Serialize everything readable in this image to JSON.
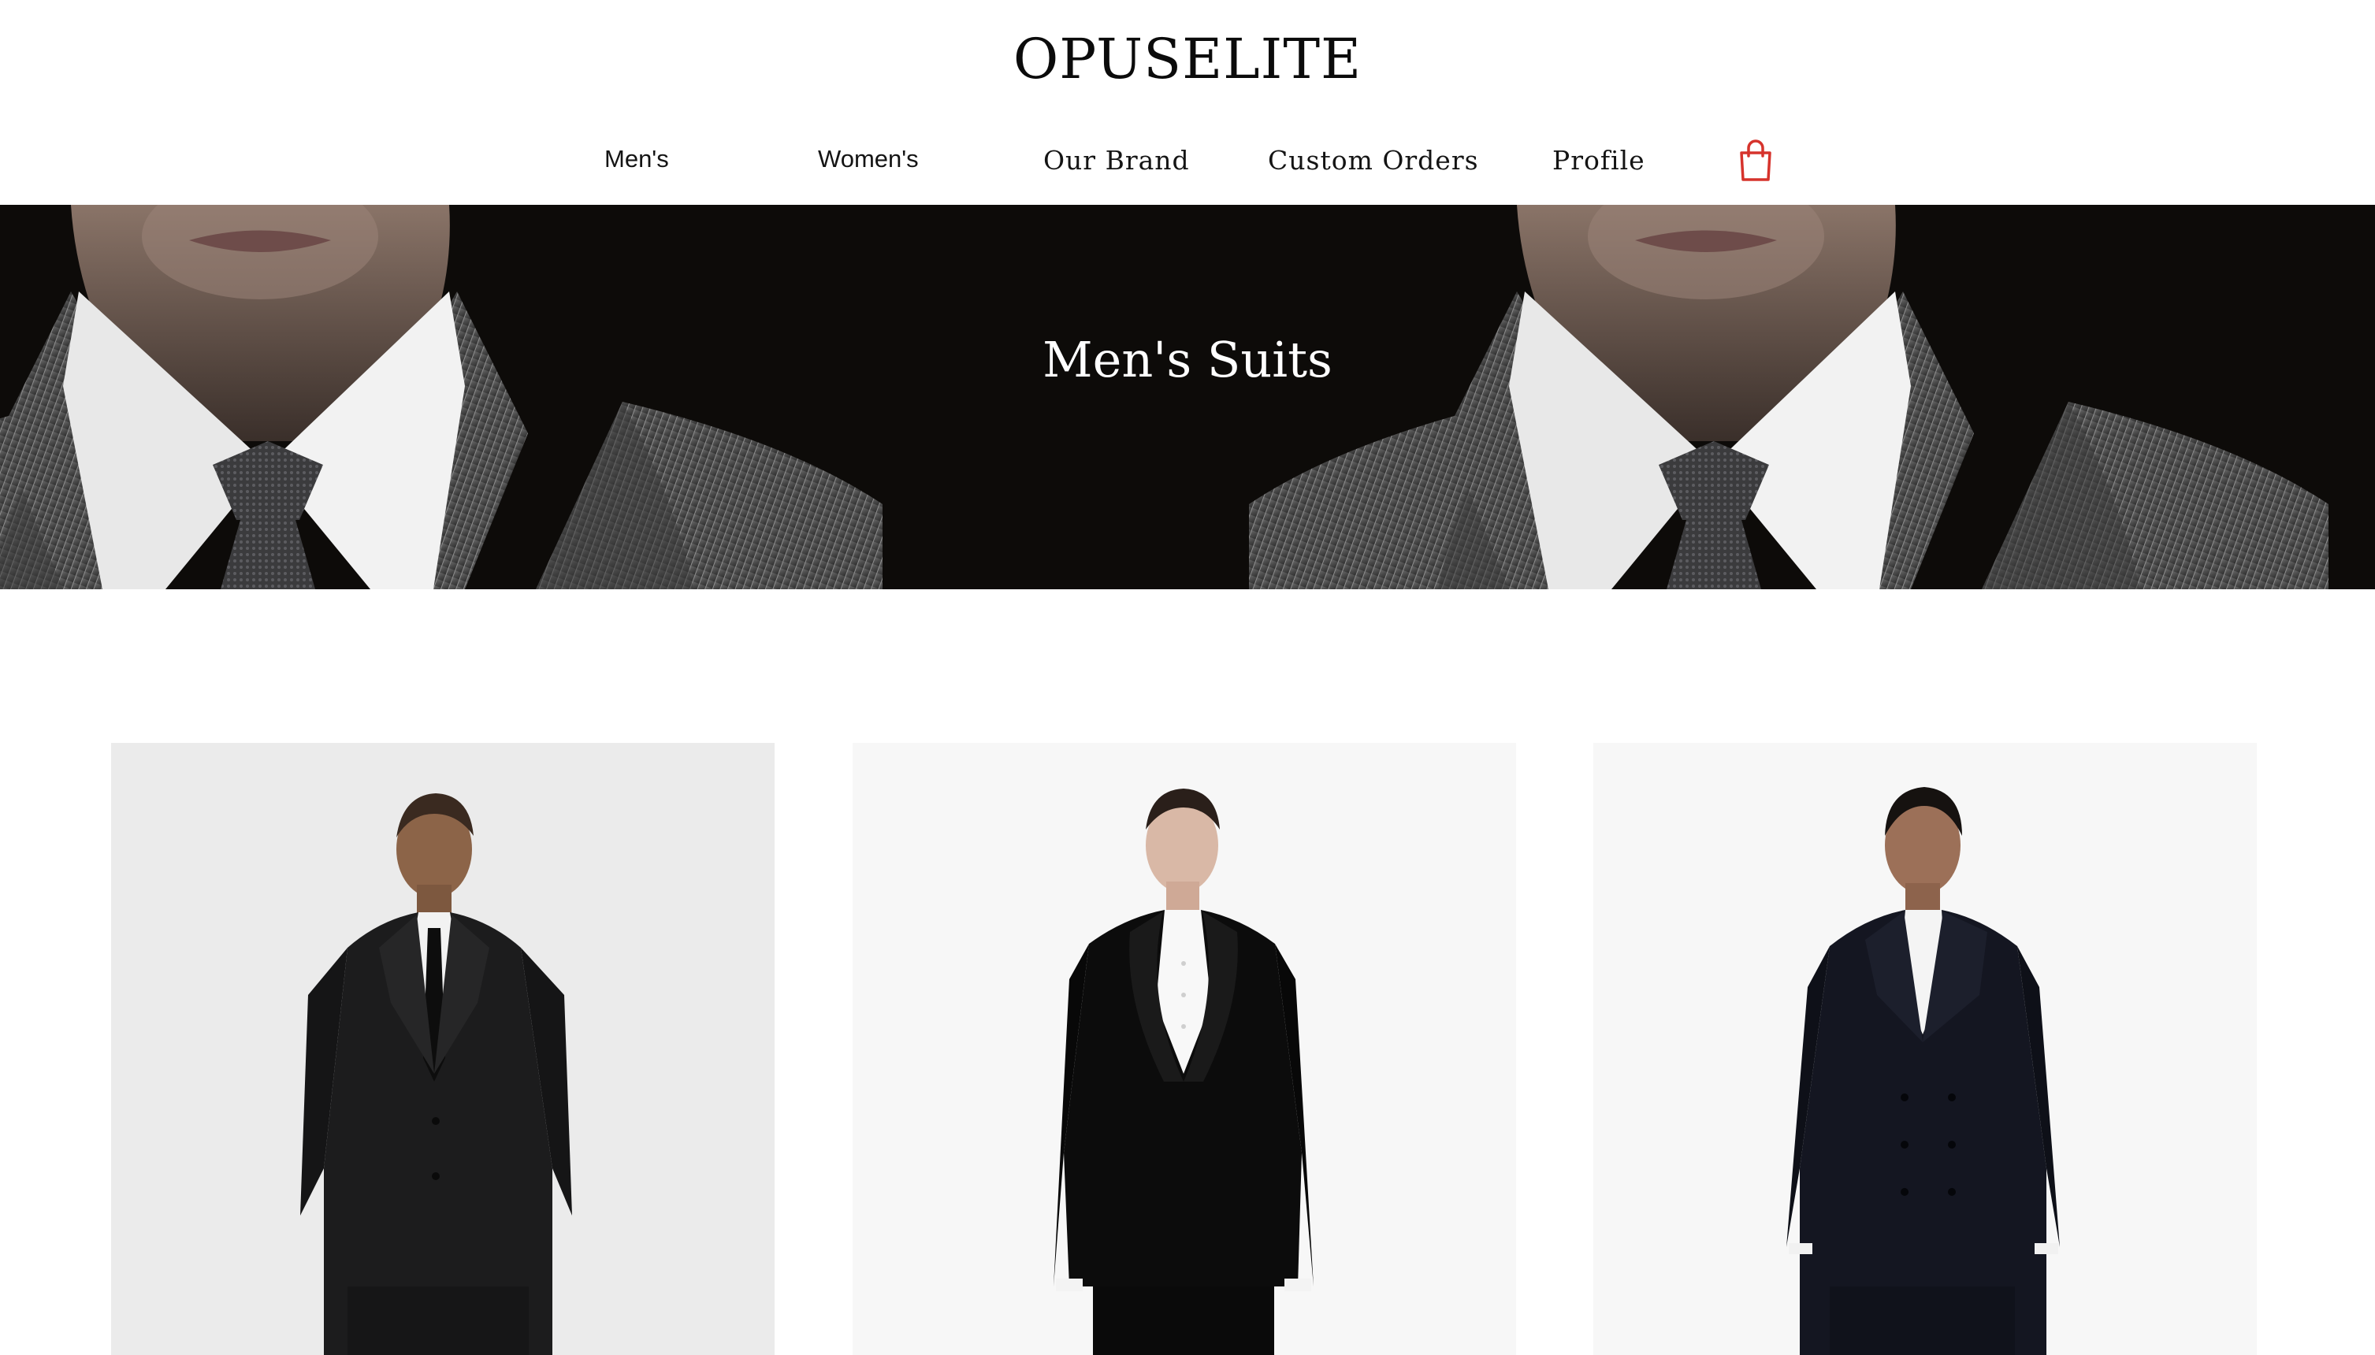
{
  "brand": {
    "name": "OPUSELITE"
  },
  "nav": {
    "items": [
      {
        "label": "Men's"
      },
      {
        "label": "Women's"
      },
      {
        "label": "Our Brand"
      },
      {
        "label": "Custom Orders"
      },
      {
        "label": "Profile"
      }
    ],
    "cart_icon": "shopping-bag-icon",
    "cart_color": "#d6332c"
  },
  "banner": {
    "title": "Men's Suits",
    "image": "man-in-grey-suit-and-tie-closeup"
  },
  "products": [
    {
      "image": "model-black-single-breasted-suit-with-tie",
      "background": "#ebebeb"
    },
    {
      "image": "model-black-shawl-lapel-tuxedo",
      "background": "#f7f7f7"
    },
    {
      "image": "model-navy-double-breasted-suit",
      "background": "#f7f7f7"
    }
  ]
}
